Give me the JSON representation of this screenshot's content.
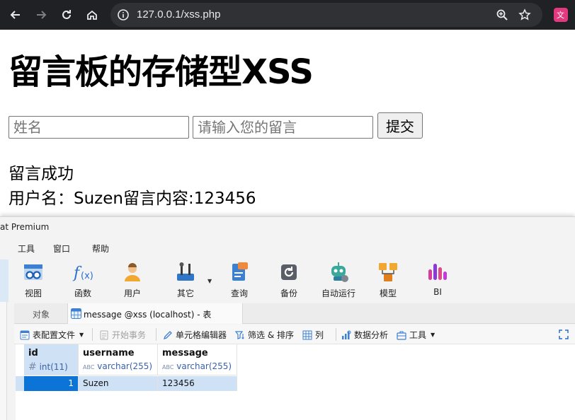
{
  "browser": {
    "url": "127.0.0.1/xss.php"
  },
  "page": {
    "title": "留言板的存储型XSS",
    "name_placeholder": "姓名",
    "message_placeholder": "请输入您的留言",
    "submit_label": "提交",
    "status_text": "留言成功",
    "result_line": "用户名：Suzen留言内容:123456"
  },
  "navicat": {
    "window_title": "at Premium",
    "menu": [
      "工具",
      "窗口",
      "帮助"
    ],
    "toolbar": [
      {
        "label": "视图",
        "icon": "view-icon"
      },
      {
        "label": "函数",
        "icon": "function-icon"
      },
      {
        "label": "用户",
        "icon": "user-icon"
      },
      {
        "label": "其它",
        "icon": "tools-icon"
      },
      {
        "label": "查询",
        "icon": "query-icon"
      },
      {
        "label": "备份",
        "icon": "backup-icon"
      },
      {
        "label": "自动运行",
        "icon": "robot-icon"
      },
      {
        "label": "模型",
        "icon": "model-icon"
      },
      {
        "label": "BI",
        "icon": "bi-icon"
      }
    ],
    "tabs": {
      "objects_label": "对象",
      "active_label": "message @xss (localhost) - 表"
    },
    "subtoolbar": {
      "config": "表配置文件",
      "begin_tx": "开始事务",
      "cell_editor": "单元格编辑器",
      "filter_sort": "筛选 & 排序",
      "columns": "列",
      "data_analysis": "数据分析",
      "tools": "工具"
    },
    "columns": [
      {
        "name": "id",
        "type_symbol": "#",
        "type": "int(11)"
      },
      {
        "name": "username",
        "type_symbol": "ABC",
        "type": "varchar(255)"
      },
      {
        "name": "message",
        "type_symbol": "ABC",
        "type": "varchar(255)"
      }
    ],
    "rows": [
      [
        "1",
        "Suzen",
        "123456"
      ]
    ],
    "colors": {
      "selected_cell": "#0b74d6",
      "selected_row": "#cfe1f5",
      "type_text": "#3a62a8"
    }
  }
}
